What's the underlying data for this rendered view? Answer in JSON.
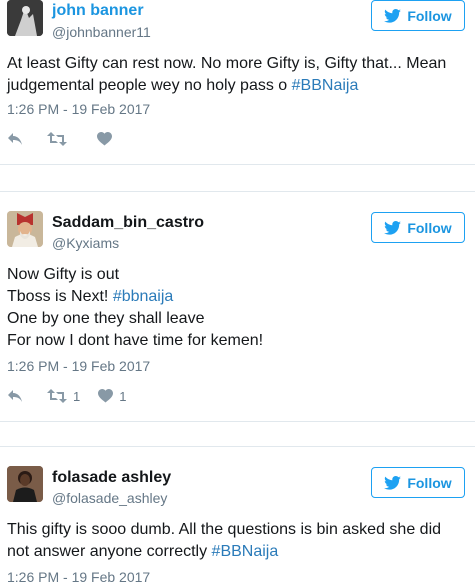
{
  "follow_label": "Follow",
  "tweets": [
    {
      "name": "john banner",
      "handle": "@johnbanner11",
      "lines": [
        {
          "text": "At least Gifty can rest now. No more Gifty is, Gifty that... Mean",
          "tag": ""
        },
        {
          "text": "judgemental people wey no holy pass o ",
          "tag": "#BBNaija"
        }
      ],
      "time": "1:26 PM - 19 Feb 2017",
      "retweets": "",
      "likes": ""
    },
    {
      "name": "Saddam_bin_castro",
      "handle": "@Kyxiams",
      "lines": [
        {
          "text": "Now Gifty is out",
          "tag": ""
        },
        {
          "text": "Tboss is Next! ",
          "tag": "#bbnaija"
        },
        {
          "text": "One by one they shall leave",
          "tag": ""
        },
        {
          "text": "For now I dont have time for kemen!",
          "tag": ""
        }
      ],
      "time": "1:26 PM - 19 Feb 2017",
      "retweets": "1",
      "likes": "1"
    },
    {
      "name": "folasade ashley",
      "handle": "@folasade_ashley",
      "lines": [
        {
          "text": "This gifty is sooo dumb. All the questions is bin asked she did",
          "tag": ""
        },
        {
          "text": "not answer anyone correctly ",
          "tag": "#BBNaija"
        }
      ],
      "time": "1:26 PM - 19 Feb 2017",
      "retweets": "",
      "likes": ""
    }
  ],
  "colors": {
    "brand": "#1da1f2",
    "link": "#2b7bb9",
    "muted": "#657786",
    "icon": "#8899a6"
  }
}
